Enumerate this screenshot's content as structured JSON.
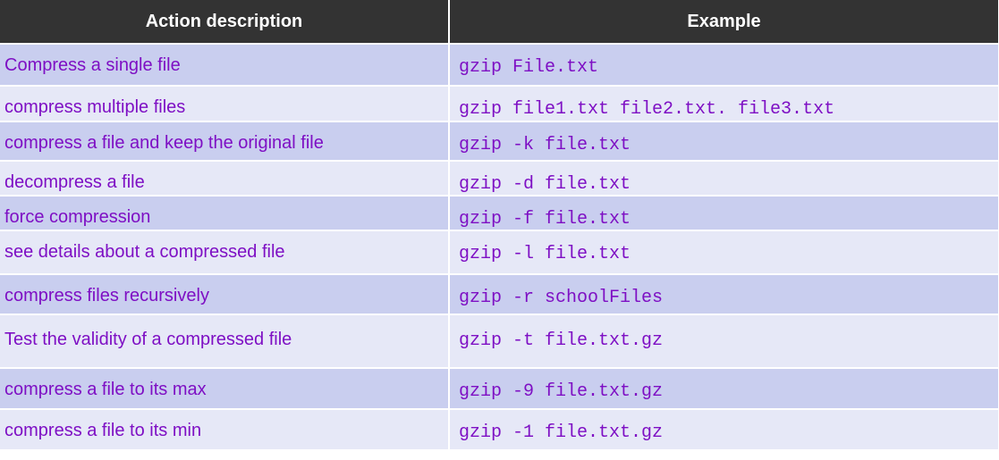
{
  "table": {
    "headers": [
      "Action description",
      "Example"
    ],
    "rows": [
      {
        "action": "Compress a single file",
        "example": "gzip File.txt"
      },
      {
        "action": "compress multiple files",
        "example": "gzip file1.txt file2.txt. file3.txt"
      },
      {
        "action": "compress a file and keep the original file",
        "example": "gzip -k file.txt"
      },
      {
        "action": "decompress a file",
        "example": "gzip -d file.txt"
      },
      {
        "action": "force compression",
        "example": "gzip -f file.txt"
      },
      {
        "action": "see details about a compressed file",
        "example": "gzip -l file.txt"
      },
      {
        "action": "compress files recursively",
        "example": "gzip -r schoolFiles"
      },
      {
        "action": "Test the validity of a compressed file",
        "example": "gzip -t file.txt.gz"
      },
      {
        "action": "compress a file to its max",
        "example": "gzip -9 file.txt.gz"
      },
      {
        "action": "compress a file to its min",
        "example": "gzip -1 file.txt.gz"
      }
    ]
  },
  "colors": {
    "header_bg": "#333333",
    "header_text": "#ffffff",
    "row_odd": "#c9ceef",
    "row_even": "#e6e8f7",
    "cell_text": "#7e0fc4"
  }
}
